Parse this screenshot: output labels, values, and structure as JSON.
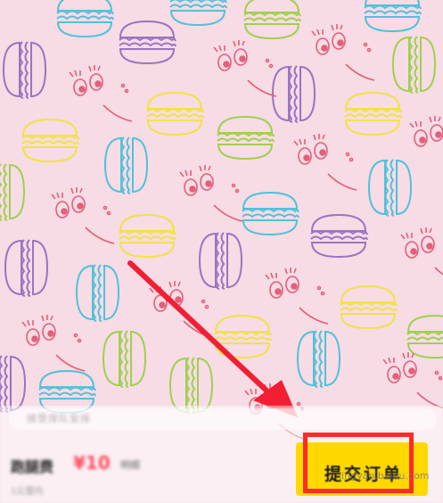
{
  "order_bar": {
    "note_placeholder": "接受排队安排",
    "price_label": "跑腿费",
    "price_value": "¥10",
    "price_detail": "明细",
    "sub_info": "1公里内",
    "submit_label": "提交订单"
  },
  "watermark": "jingyan.baidu.com",
  "colors": {
    "background": "#f7dbe5",
    "submit_button": "#ffd800",
    "annotation": "#ff2a2a",
    "price": "#ff4d5e"
  },
  "icons": [
    "macaron-pattern",
    "cartoon-face-pattern",
    "annotation-arrow",
    "highlight-box"
  ]
}
